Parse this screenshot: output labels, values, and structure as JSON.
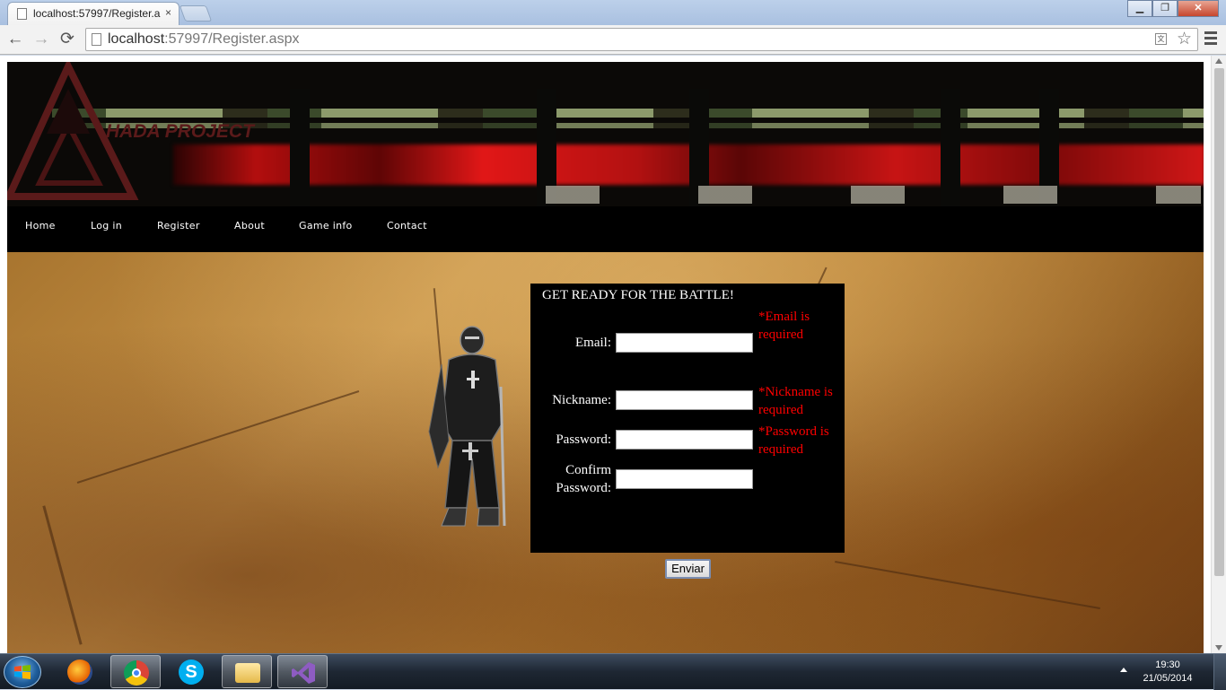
{
  "browser": {
    "tab_title": "localhost:57997/Register.a",
    "tab_close": "×",
    "url_host": "localhost",
    "url_rest": ":57997/Register.aspx",
    "win_min": "▁",
    "win_max": "❐",
    "win_close": "✕",
    "back_icon": "←",
    "forward_icon": "→",
    "reload_icon": "⟳",
    "star_icon": "☆",
    "translate_icon": "文"
  },
  "site": {
    "logo_text": "HADA PROJECT",
    "nav": [
      "Home",
      "Log in",
      "Register",
      "About",
      "Game info",
      "Contact"
    ]
  },
  "form": {
    "title": "GET READY FOR THE BATTLE!",
    "email_label": "Email:",
    "email_value": "",
    "email_error": "*Email is required",
    "nickname_label": "Nickname:",
    "nickname_value": "",
    "nickname_error": "*Nickname is required",
    "password_label": "Password:",
    "password_value": "",
    "password_error": "*Password is required",
    "confirm_label": "Confirm Password:",
    "confirm_value": "",
    "submit_label": "Enviar"
  },
  "taskbar": {
    "time": "19:30",
    "date": "21/05/2014",
    "apps": [
      "windows-start",
      "firefox",
      "chrome",
      "skype",
      "file-explorer",
      "visual-studio"
    ]
  },
  "colors": {
    "error": "#ff0000",
    "form_bg": "#000000",
    "nav_bg": "#000000"
  }
}
